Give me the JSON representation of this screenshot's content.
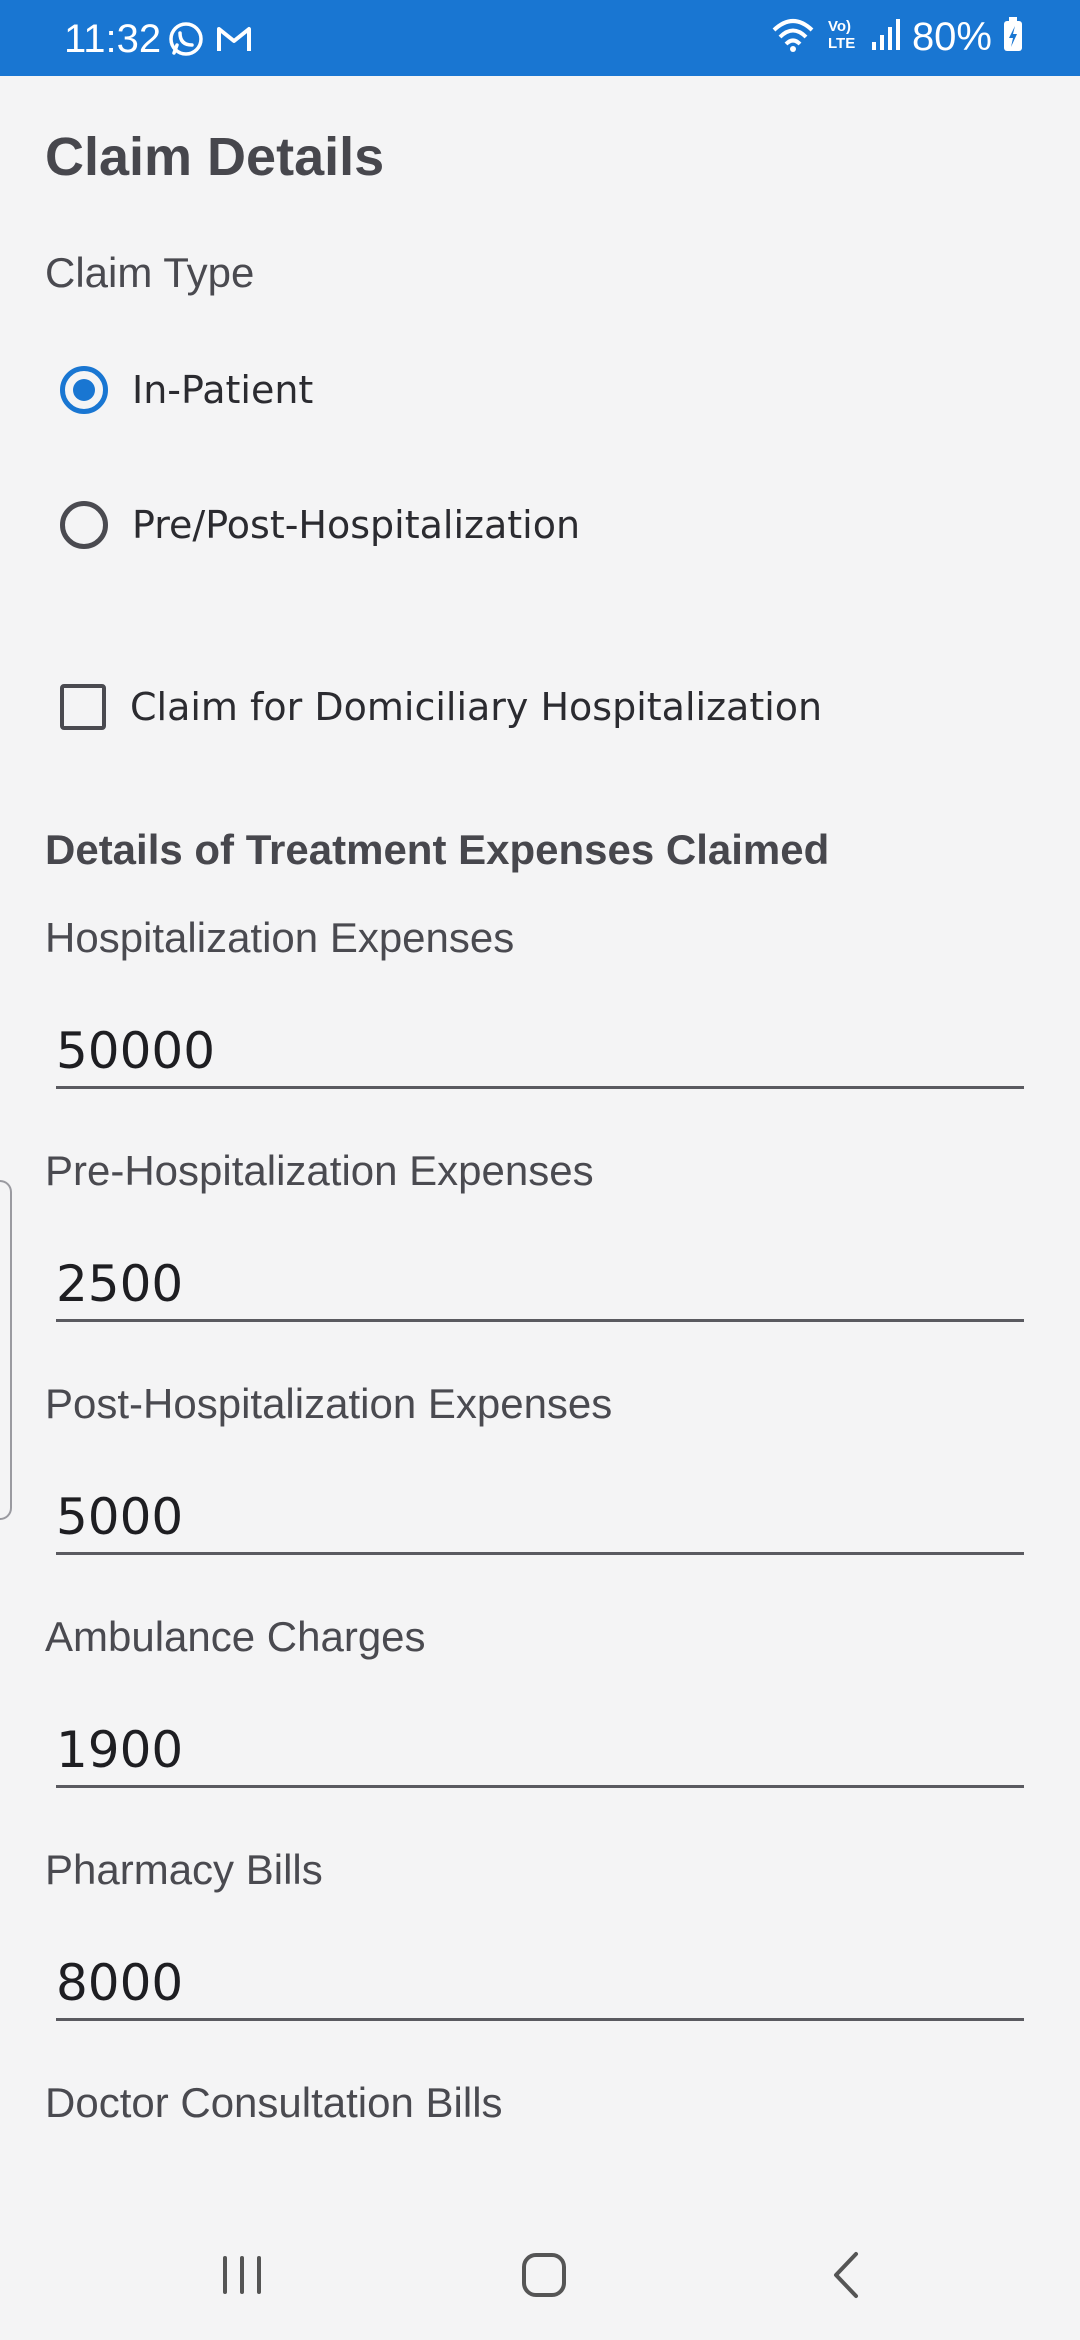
{
  "status_bar": {
    "time": "11:32",
    "left_icons": [
      "whatsapp-icon",
      "gmail-icon"
    ],
    "right_icons": [
      "wifi-icon",
      "volte-icon",
      "signal-icon"
    ],
    "battery": "80%",
    "color": "#1976d2"
  },
  "page": {
    "title": "Claim Details"
  },
  "claim_type": {
    "label": "Claim Type",
    "options": [
      {
        "label": "In-Patient",
        "selected": true
      },
      {
        "label": "Pre/Post-Hospitalization",
        "selected": false
      }
    ],
    "domiciliary": {
      "label": "Claim for Domiciliary Hospitalization",
      "checked": false
    }
  },
  "expenses": {
    "heading": "Details of Treatment Expenses Claimed",
    "fields": [
      {
        "label": "Hospitalization Expenses",
        "value": "50000"
      },
      {
        "label": "Pre-Hospitalization Expenses",
        "value": "2500"
      },
      {
        "label": "Post-Hospitalization Expenses",
        "value": "5000"
      },
      {
        "label": "Ambulance Charges",
        "value": "1900"
      },
      {
        "label": "Pharmacy Bills",
        "value": "8000"
      },
      {
        "label": "Doctor Consultation Bills",
        "value": ""
      }
    ]
  },
  "nav_bar": {
    "buttons": [
      "recents-icon",
      "home-icon",
      "back-icon"
    ]
  }
}
